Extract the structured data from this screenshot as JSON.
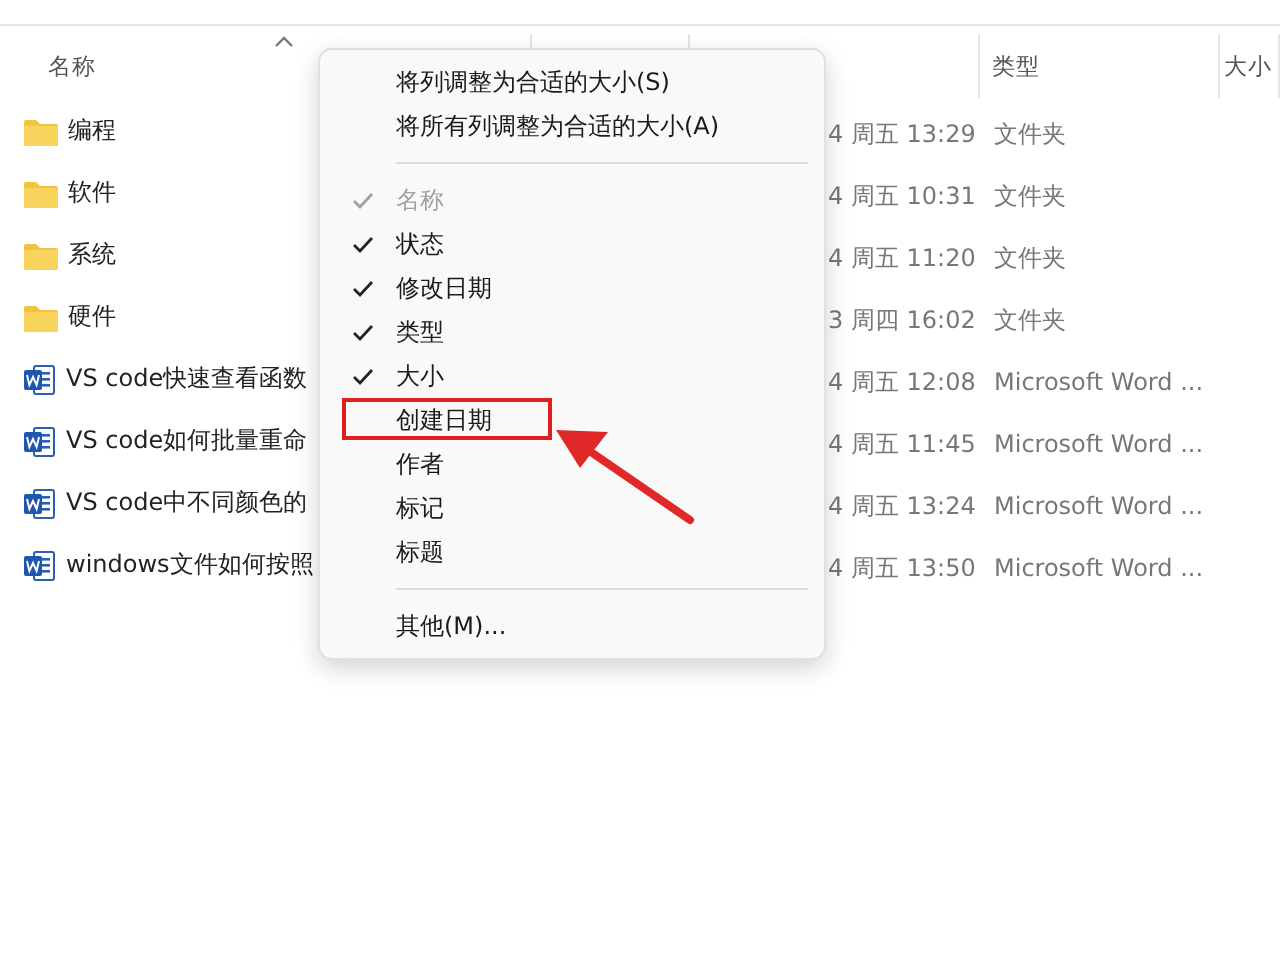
{
  "table": {
    "columns": [
      {
        "label": "名称",
        "sorted": true
      },
      {
        "label": "类型",
        "sorted": false
      },
      {
        "label": "大小",
        "sorted": false
      }
    ],
    "rows": [
      {
        "kind": "folder",
        "name": "编程",
        "date": "4 周五 13:29",
        "type": "文件夹"
      },
      {
        "kind": "folder",
        "name": "软件",
        "date": "4 周五 10:31",
        "type": "文件夹"
      },
      {
        "kind": "folder",
        "name": "系统",
        "date": "4 周五 11:20",
        "type": "文件夹"
      },
      {
        "kind": "folder",
        "name": "硬件",
        "date": "3 周四 16:02",
        "type": "文件夹"
      },
      {
        "kind": "word",
        "name": "VS code快速查看函数",
        "date": "4 周五 12:08",
        "type": "Microsoft Word ..."
      },
      {
        "kind": "word",
        "name": "VS code如何批量重命",
        "date": "4 周五 11:45",
        "type": "Microsoft Word ..."
      },
      {
        "kind": "word",
        "name": "VS code中不同颜色的",
        "date": "4 周五 13:24",
        "type": "Microsoft Word ..."
      },
      {
        "kind": "word",
        "name": "windows文件如何按照",
        "date": "4 周五 13:50",
        "type": "Microsoft Word ..."
      }
    ]
  },
  "context_menu": {
    "items": [
      {
        "kind": "command",
        "label": "将列调整为合适的大小(S)"
      },
      {
        "kind": "command",
        "label": "将所有列调整为合适的大小(A)"
      },
      {
        "kind": "separator"
      },
      {
        "kind": "column",
        "label": "名称",
        "checked": true,
        "disabled": true,
        "highlighted": false
      },
      {
        "kind": "column",
        "label": "状态",
        "checked": true,
        "disabled": false,
        "highlighted": false
      },
      {
        "kind": "column",
        "label": "修改日期",
        "checked": true,
        "disabled": false,
        "highlighted": false
      },
      {
        "kind": "column",
        "label": "类型",
        "checked": true,
        "disabled": false,
        "highlighted": false
      },
      {
        "kind": "column",
        "label": "大小",
        "checked": true,
        "disabled": false,
        "highlighted": false
      },
      {
        "kind": "column",
        "label": "创建日期",
        "checked": false,
        "disabled": false,
        "highlighted": true
      },
      {
        "kind": "column",
        "label": "作者",
        "checked": false,
        "disabled": false,
        "highlighted": false
      },
      {
        "kind": "column",
        "label": "标记",
        "checked": false,
        "disabled": false,
        "highlighted": false
      },
      {
        "kind": "column",
        "label": "标题",
        "checked": false,
        "disabled": false,
        "highlighted": false
      },
      {
        "kind": "separator"
      },
      {
        "kind": "command",
        "label": "其他(M)..."
      }
    ]
  }
}
